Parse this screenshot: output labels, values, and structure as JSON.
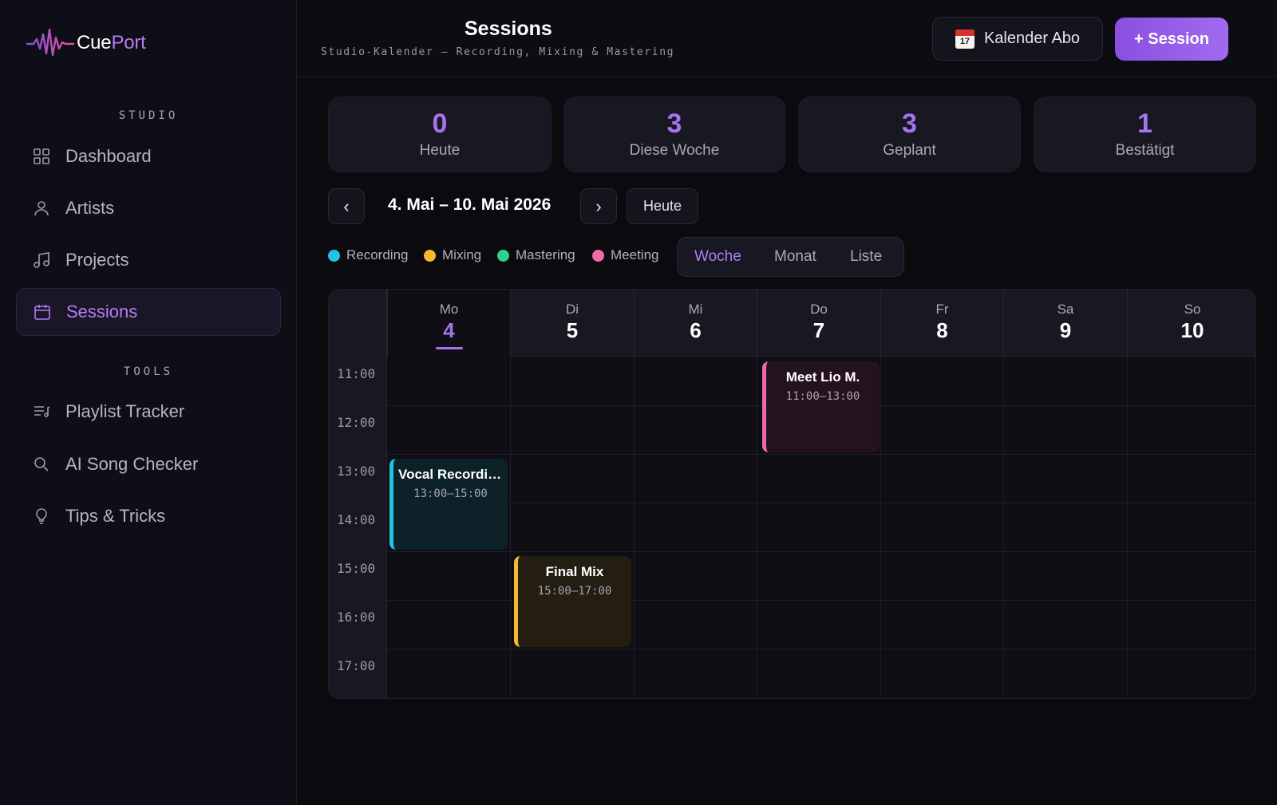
{
  "app": {
    "logo_a": "Cue",
    "logo_b": "Port",
    "brand_color": "#b37cf3"
  },
  "sidebar": {
    "studio_title": "STUDIO",
    "tools_title": "TOOLS",
    "studio_items": [
      {
        "label": "Dashboard",
        "icon": "grid-icon"
      },
      {
        "label": "Artists",
        "icon": "user-icon"
      },
      {
        "label": "Projects",
        "icon": "music-note-icon"
      },
      {
        "label": "Sessions",
        "icon": "calendar-icon",
        "active": true
      }
    ],
    "tools_items": [
      {
        "label": "Playlist Tracker",
        "icon": "playlist-icon"
      },
      {
        "label": "AI Song Checker",
        "icon": "search-icon"
      },
      {
        "label": "Tips & Tricks",
        "icon": "lightbulb-icon"
      }
    ]
  },
  "header": {
    "title": "Sessions",
    "subtitle": "Studio-Kalender — Recording, Mixing & Mastering",
    "calendar_button": "Kalender Abo",
    "calendar_icon_day": "17",
    "add_button": "+ Session"
  },
  "stats": [
    {
      "value": "0",
      "label": "Heute"
    },
    {
      "value": "3",
      "label": "Diese Woche"
    },
    {
      "value": "3",
      "label": "Geplant"
    },
    {
      "value": "1",
      "label": "Bestätigt"
    }
  ],
  "week_nav": {
    "prev": "‹",
    "next": "›",
    "range": "4. Mai – 10. Mai 2026",
    "today_button": "Heute"
  },
  "legend": [
    {
      "label": "Recording",
      "color": "#22c3e6"
    },
    {
      "label": "Mixing",
      "color": "#f5b82e"
    },
    {
      "label": "Mastering",
      "color": "#2ecf8f"
    },
    {
      "label": "Meeting",
      "color": "#f06aa8"
    }
  ],
  "view_tabs": [
    {
      "label": "Woche",
      "active": true
    },
    {
      "label": "Monat"
    },
    {
      "label": "Liste"
    }
  ],
  "calendar": {
    "days": [
      {
        "name": "Mo",
        "date": "4",
        "today": true
      },
      {
        "name": "Di",
        "date": "5"
      },
      {
        "name": "Mi",
        "date": "6"
      },
      {
        "name": "Do",
        "date": "7"
      },
      {
        "name": "Fr",
        "date": "8"
      },
      {
        "name": "Sa",
        "date": "9"
      },
      {
        "name": "So",
        "date": "10"
      }
    ],
    "hours": [
      "11:00",
      "12:00",
      "13:00",
      "14:00",
      "15:00",
      "16:00",
      "17:00"
    ],
    "events": [
      {
        "title": "Meet Lio M.",
        "time": "11:00–13:00",
        "type": "Meeting",
        "color": "#f06aa8",
        "bg": "#24131f"
      },
      {
        "title": "Vocal Recording",
        "time": "13:00–15:00",
        "type": "Recording",
        "color": "#22c3e6",
        "bg": "#0c2128"
      },
      {
        "title": "Final Mix",
        "time": "15:00–17:00",
        "type": "Mixing",
        "color": "#f5b82e",
        "bg": "#231d12"
      }
    ]
  }
}
